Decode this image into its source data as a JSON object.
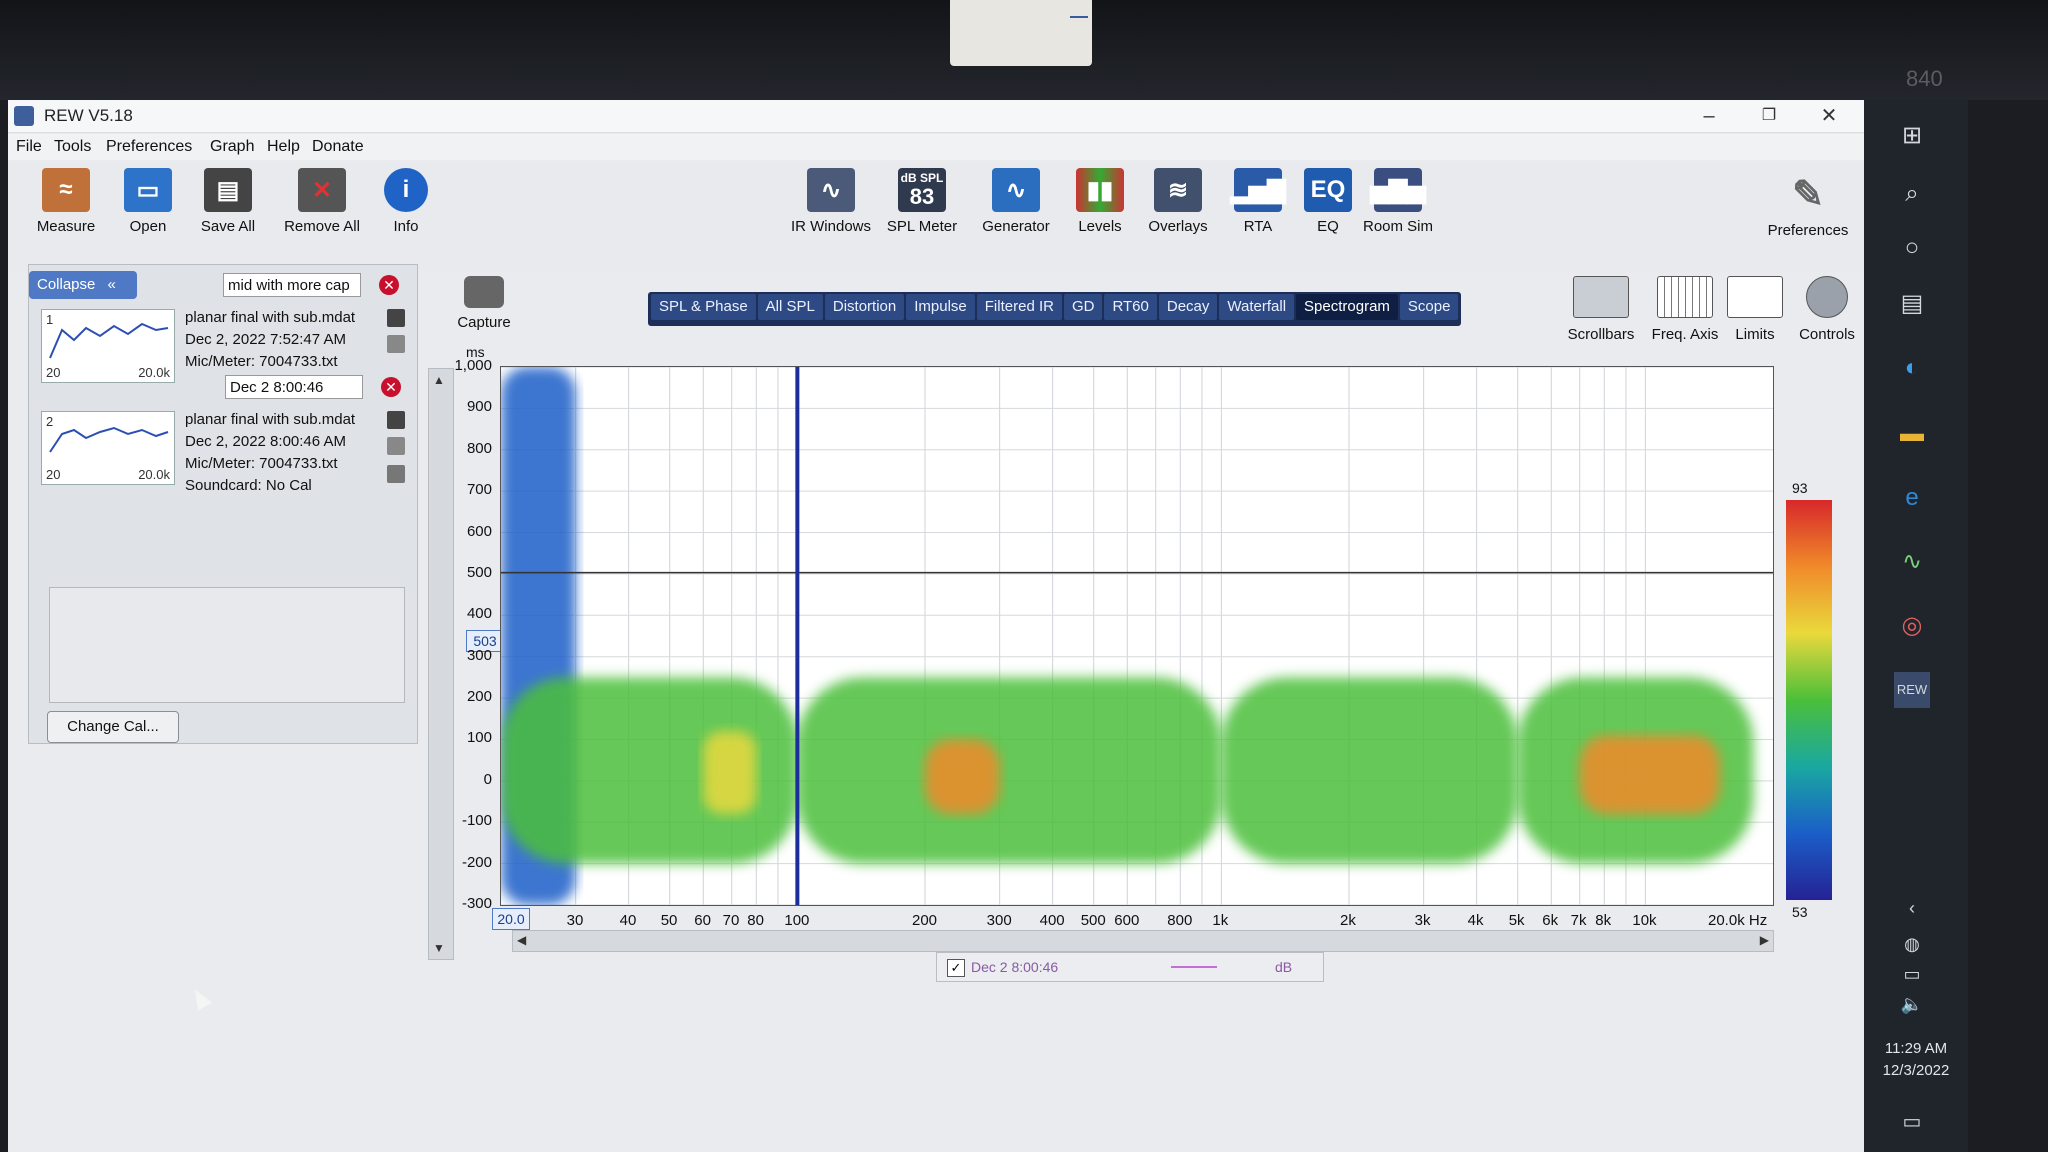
{
  "window": {
    "title": "REW V5.18",
    "minimize_icon": "minimize-icon",
    "restore_icon": "restore-icon",
    "close_icon": "close-icon"
  },
  "device": {
    "brand_number": "840"
  },
  "menu": [
    "File",
    "Tools",
    "Preferences",
    "Graph",
    "Help",
    "Donate"
  ],
  "toolbar_left": [
    "Measure",
    "Open",
    "Save All",
    "Remove All",
    "Info"
  ],
  "toolbar_center": [
    "IR Windows",
    "SPL Meter",
    "Generator",
    "Levels",
    "Overlays",
    "RTA",
    "EQ",
    "Room Sim"
  ],
  "spl_meter_badge": {
    "unit": "dB SPL",
    "value": "83"
  },
  "toolbar_right": [
    "Preferences"
  ],
  "left_panel": {
    "collapse_label": "Collapse",
    "measurements": [
      {
        "index": "1",
        "name_field": "mid with more cap",
        "title": "planar final with sub.mdat",
        "date": "Dec 2, 2022 7:52:47 AM",
        "mic": "Mic/Meter: 7004733.txt",
        "thumb_lo": "20",
        "thumb_hi": "20.0k"
      },
      {
        "index": "2",
        "name_field": "Dec 2 8:00:46",
        "title": "planar final with sub.mdat",
        "date": "Dec 2, 2022 8:00:46 AM",
        "mic": "Mic/Meter: 7004733.txt",
        "soundcard": "Soundcard: No Cal",
        "thumb_lo": "20",
        "thumb_hi": "20.0k"
      }
    ],
    "change_cal_label": "Change Cal..."
  },
  "capture_label": "Capture",
  "graph_tabs": [
    {
      "label": "SPL & Phase",
      "active": false
    },
    {
      "label": "All SPL",
      "active": false
    },
    {
      "label": "Distortion",
      "active": false
    },
    {
      "label": "Impulse",
      "active": false
    },
    {
      "label": "Filtered IR",
      "active": false
    },
    {
      "label": "GD",
      "active": false
    },
    {
      "label": "RT60",
      "active": false
    },
    {
      "label": "Decay",
      "active": false
    },
    {
      "label": "Waterfall",
      "active": false
    },
    {
      "label": "Spectrogram",
      "active": true
    },
    {
      "label": "Scope",
      "active": false
    }
  ],
  "graph_controls": [
    "Scrollbars",
    "Freq. Axis",
    "Limits",
    "Controls"
  ],
  "plot": {
    "y_unit": "ms",
    "y_ticks": [
      "1,000",
      "900",
      "800",
      "700",
      "600",
      "500",
      "400",
      "300",
      "200",
      "100",
      "0",
      "-100",
      "-200",
      "-300"
    ],
    "y_cursor": "503",
    "x_start": "20.0",
    "x_ticks": [
      "30",
      "40",
      "50",
      "60",
      "70",
      "80",
      "100",
      "200",
      "300",
      "400",
      "500",
      "600",
      "800",
      "1k",
      "2k",
      "3k",
      "4k",
      "5k",
      "6k",
      "7k",
      "8k",
      "10k",
      "20.0k Hz"
    ],
    "colorbar_max": "93",
    "colorbar_min": "53",
    "legend": {
      "name": "Dec 2 8:00:46",
      "unit": "dB",
      "color": "#c36fd6"
    }
  },
  "taskbar": {
    "time": "11:29 AM",
    "date": "12/3/2022"
  },
  "chart_data": {
    "type": "heatmap",
    "x_scale": "log",
    "xlim": [
      20,
      20000
    ],
    "ylim": [
      -300,
      1000
    ],
    "ylabel": "ms",
    "y_cursor": 503,
    "colorbar_range_db": [
      53,
      93
    ],
    "bands": [
      {
        "f_lo": 20,
        "f_hi": 30,
        "t_lo": -300,
        "t_hi": 1000,
        "level": 0.35
      },
      {
        "f_lo": 20,
        "f_hi": 100,
        "t_lo": -200,
        "t_hi": 250,
        "level": 0.6
      },
      {
        "f_lo": 60,
        "f_hi": 80,
        "t_lo": -80,
        "t_hi": 120,
        "level": 0.85
      },
      {
        "f_lo": 100,
        "f_hi": 1000,
        "t_lo": -200,
        "t_hi": 250,
        "level": 0.65
      },
      {
        "f_lo": 200,
        "f_hi": 300,
        "t_lo": -80,
        "t_hi": 100,
        "level": 0.9
      },
      {
        "f_lo": 1000,
        "f_hi": 5000,
        "t_lo": -200,
        "t_hi": 250,
        "level": 0.6
      },
      {
        "f_lo": 5000,
        "f_hi": 18000,
        "t_lo": -200,
        "t_hi": 250,
        "level": 0.7
      },
      {
        "f_lo": 7000,
        "f_hi": 15000,
        "t_lo": -80,
        "t_hi": 110,
        "level": 0.9
      }
    ]
  }
}
